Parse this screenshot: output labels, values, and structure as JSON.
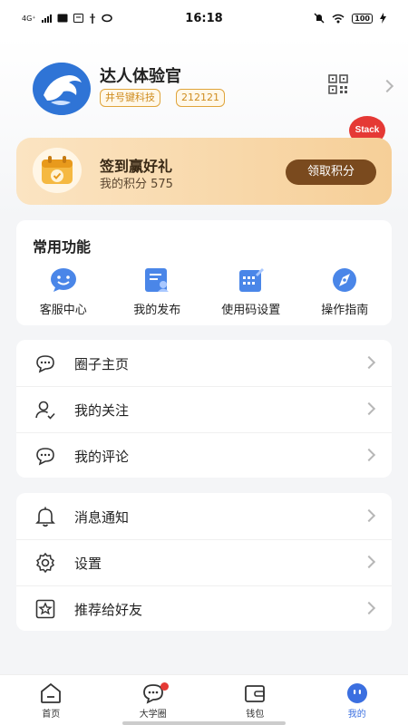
{
  "status_bar": {
    "time": "16:18",
    "network": "4G⁺",
    "battery": "100"
  },
  "profile": {
    "name": "达人体验官",
    "badge_org": "井号键科技",
    "badge_id": "212121",
    "floating_button": "Stack"
  },
  "checkin": {
    "title": "签到赢好礼",
    "points_text": "我的积分 575",
    "button": "领取积分"
  },
  "functions": {
    "title": "常用功能",
    "items": [
      {
        "label": "客服中心",
        "icon": "customer-service-icon"
      },
      {
        "label": "我的发布",
        "icon": "my-post-icon"
      },
      {
        "label": "使用码设置",
        "icon": "code-settings-icon"
      },
      {
        "label": "操作指南",
        "icon": "compass-icon"
      }
    ]
  },
  "list1": {
    "items": [
      {
        "label": "圈子主页",
        "icon": "chat-bubble-icon"
      },
      {
        "label": "我的关注",
        "icon": "user-check-icon"
      },
      {
        "label": "我的评论",
        "icon": "comment-icon"
      }
    ]
  },
  "list2": {
    "items": [
      {
        "label": "消息通知",
        "icon": "bell-icon"
      },
      {
        "label": "设置",
        "icon": "gear-icon"
      },
      {
        "label": "推荐给好友",
        "icon": "star-share-icon"
      }
    ]
  },
  "tabbar": {
    "tabs": [
      {
        "label": "首页",
        "icon": "home-icon",
        "active": false
      },
      {
        "label": "大学圈",
        "icon": "circle-chat-icon",
        "active": false
      },
      {
        "label": "钱包",
        "icon": "wallet-icon",
        "active": false
      },
      {
        "label": "我的",
        "icon": "me-icon",
        "active": true
      }
    ]
  },
  "colors": {
    "accent": "#3b6fe0",
    "checkin_button": "#7a4a1e",
    "badge": "#cf8d1f",
    "notification_dot": "#e53935"
  }
}
